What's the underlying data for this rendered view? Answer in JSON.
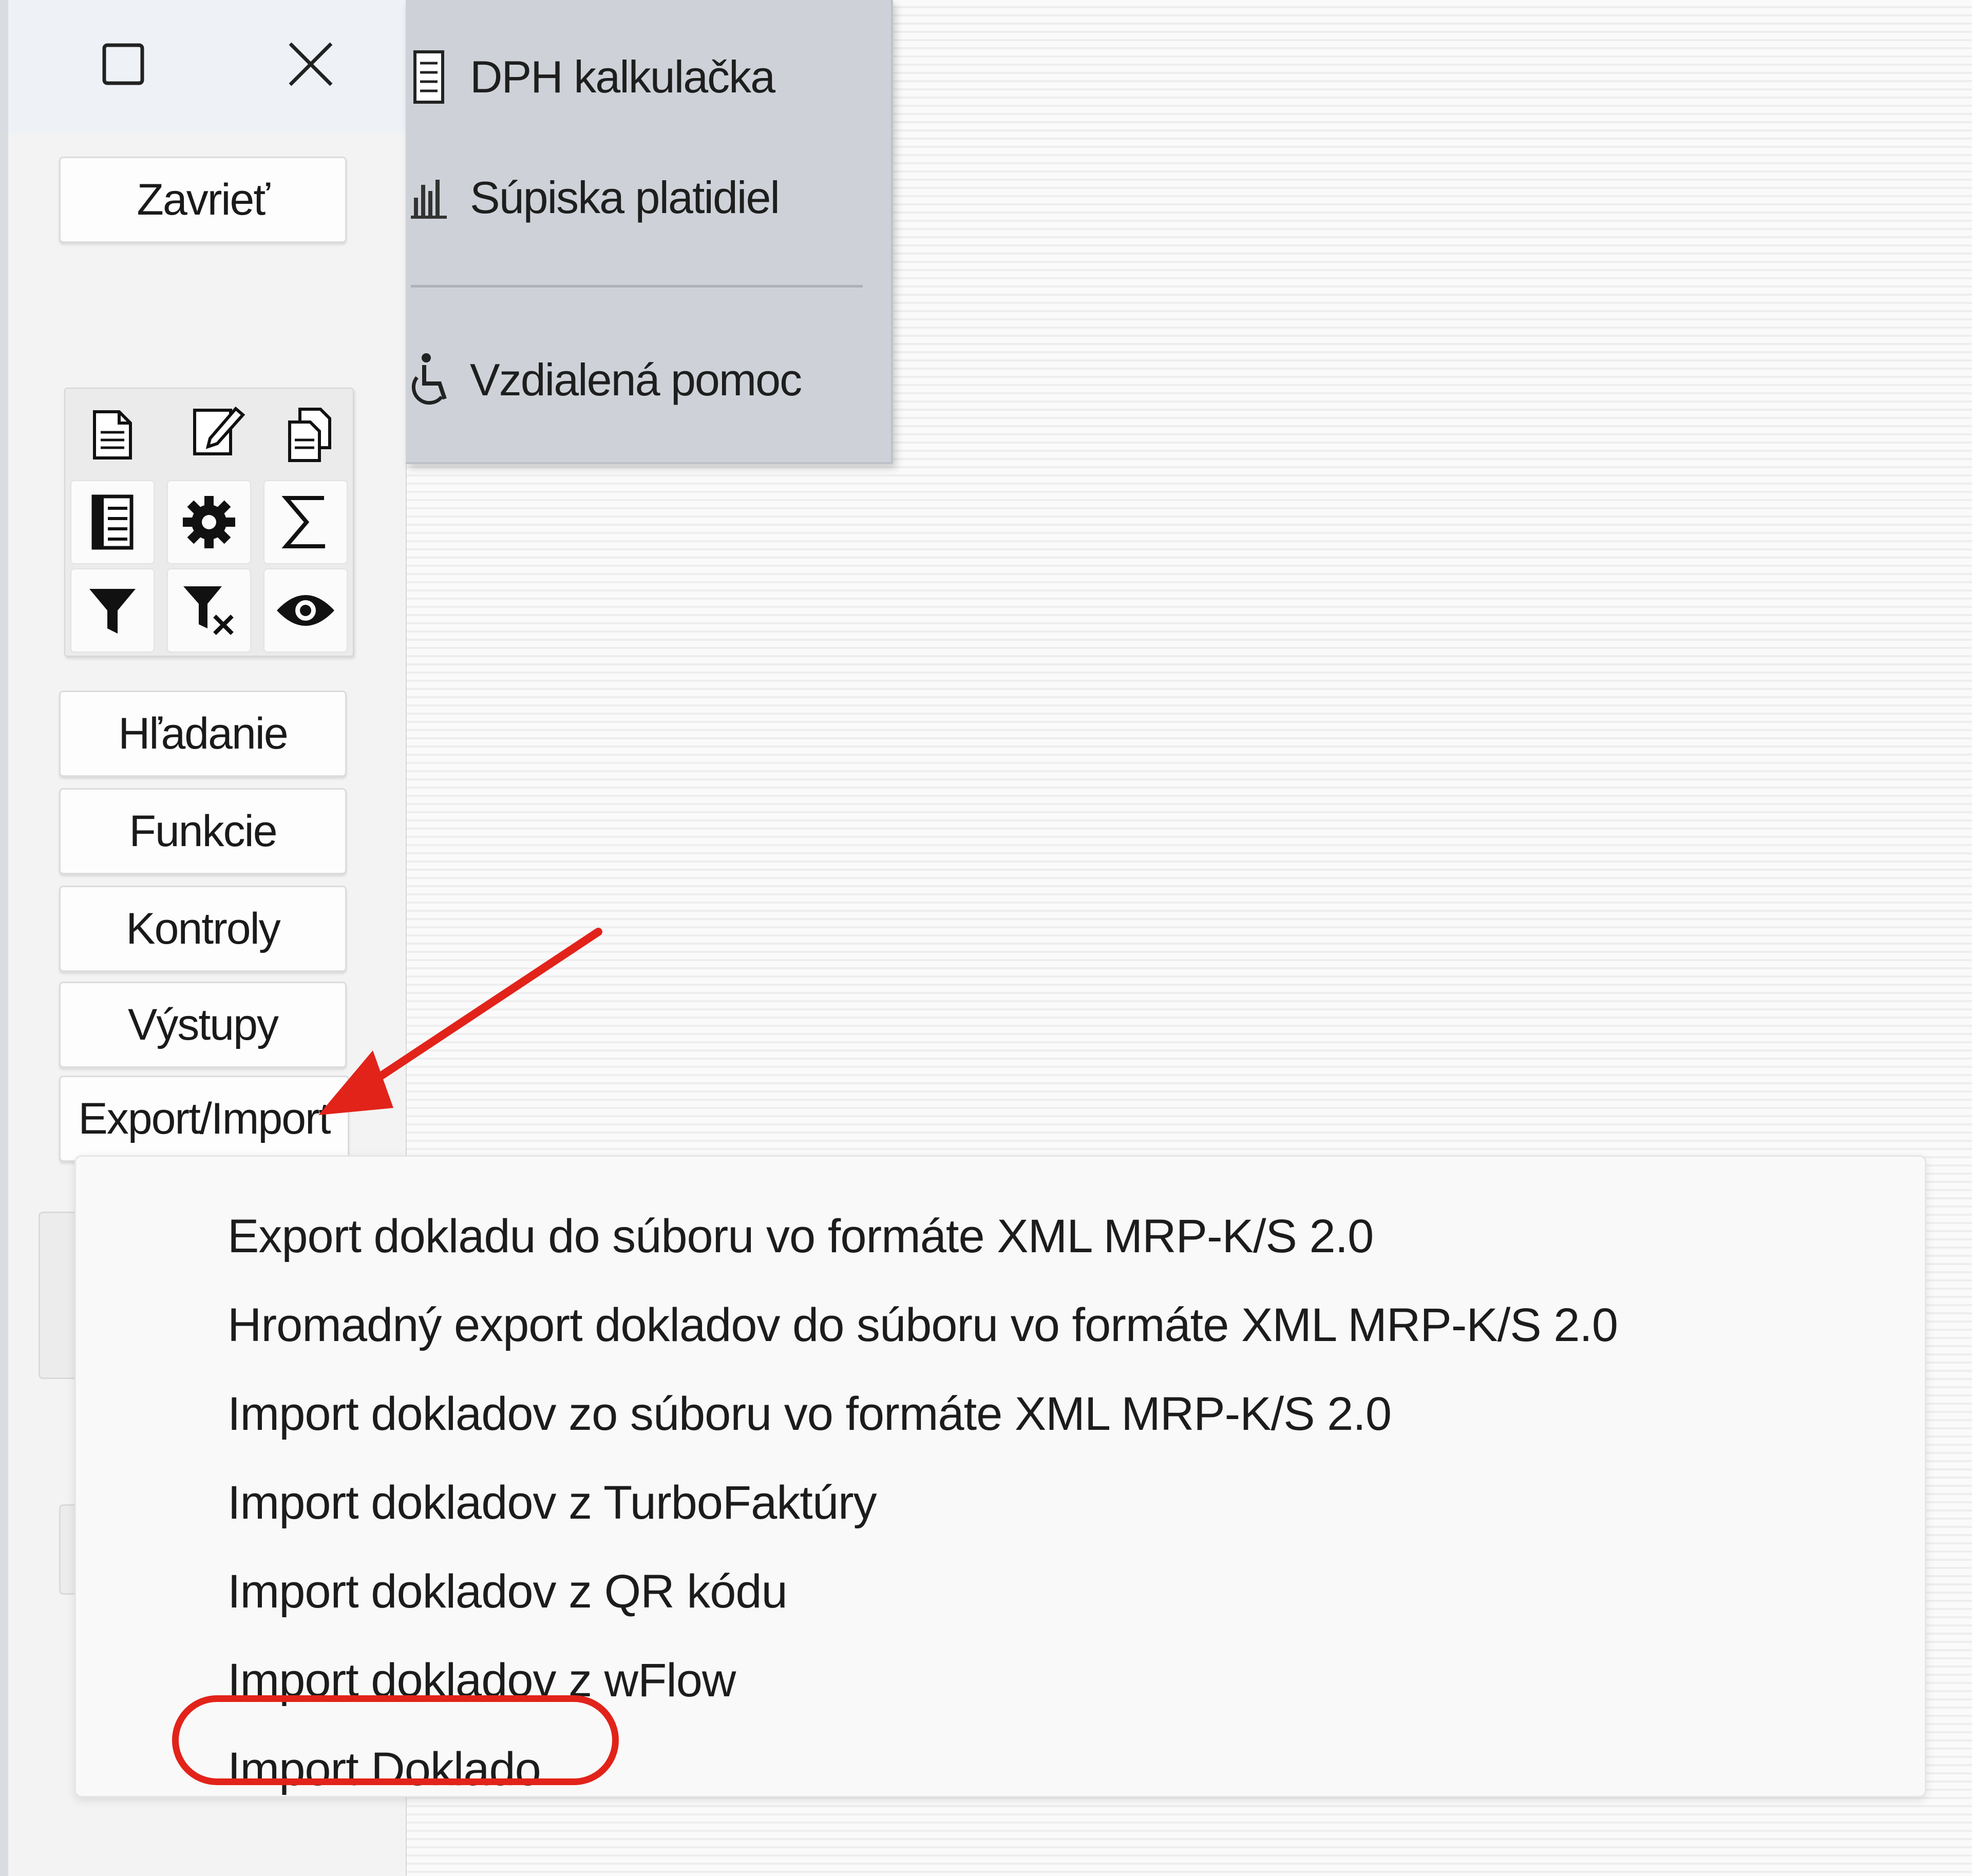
{
  "window": {
    "maximize_icon": "maximize-square-icon",
    "close_icon": "close-x-icon"
  },
  "toolbar": {
    "close_label": "Zavrieť",
    "icons": [
      "new-document-icon",
      "edit-document-icon",
      "copy-document-icon",
      "list-icon",
      "settings-gear-icon",
      "sum-sigma-icon",
      "filter-icon",
      "clear-filter-icon",
      "view-eye-icon"
    ],
    "buttons": {
      "search": "Hľadanie",
      "functions": "Funkcie",
      "checks": "Kontroly",
      "outputs": "Výstupy",
      "export_import": "Export/Import"
    }
  },
  "top_menu": {
    "items": [
      {
        "label": "DPH kalkulačka",
        "icon": "calculator-icon"
      },
      {
        "label": "Súpiska platidiel",
        "icon": "bar-chart-icon"
      },
      {
        "label": "Vzdialená pomoc",
        "icon": "accessibility-icon"
      }
    ]
  },
  "popup_menu": {
    "items": [
      "Export dokladu do súboru vo formáte XML MRP-K/S 2.0",
      "Hromadný export dokladov do súboru vo formáte XML MRP-K/S 2.0",
      "Import dokladov zo súboru vo formáte XML MRP-K/S 2.0",
      "Import dokladov z TurboFaktúry",
      "Import dokladov z QR kódu",
      "Import dokladov z wFlow",
      "Import Doklado"
    ]
  },
  "annotation": {
    "color": "#e2231a"
  }
}
